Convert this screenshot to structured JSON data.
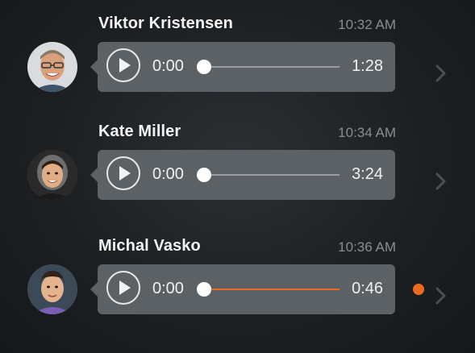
{
  "accent_color": "#ef6a21",
  "messages": [
    {
      "sender": "Viktor Kristensen",
      "time": "10:32 AM",
      "current_time": "0:00",
      "duration": "1:28",
      "progress": 0,
      "track_color": "#9a9ea2",
      "unread": false,
      "avatar_icon": "avatar-viktor-icon"
    },
    {
      "sender": "Kate Miller",
      "time": "10:34 AM",
      "current_time": "0:00",
      "duration": "3:24",
      "progress": 0,
      "track_color": "#9a9ea2",
      "unread": false,
      "avatar_icon": "avatar-kate-icon"
    },
    {
      "sender": "Michal Vasko",
      "time": "10:36 AM",
      "current_time": "0:00",
      "duration": "0:46",
      "progress": 0,
      "track_color": "#ef6a21",
      "unread": true,
      "avatar_icon": "avatar-michal-icon"
    }
  ]
}
